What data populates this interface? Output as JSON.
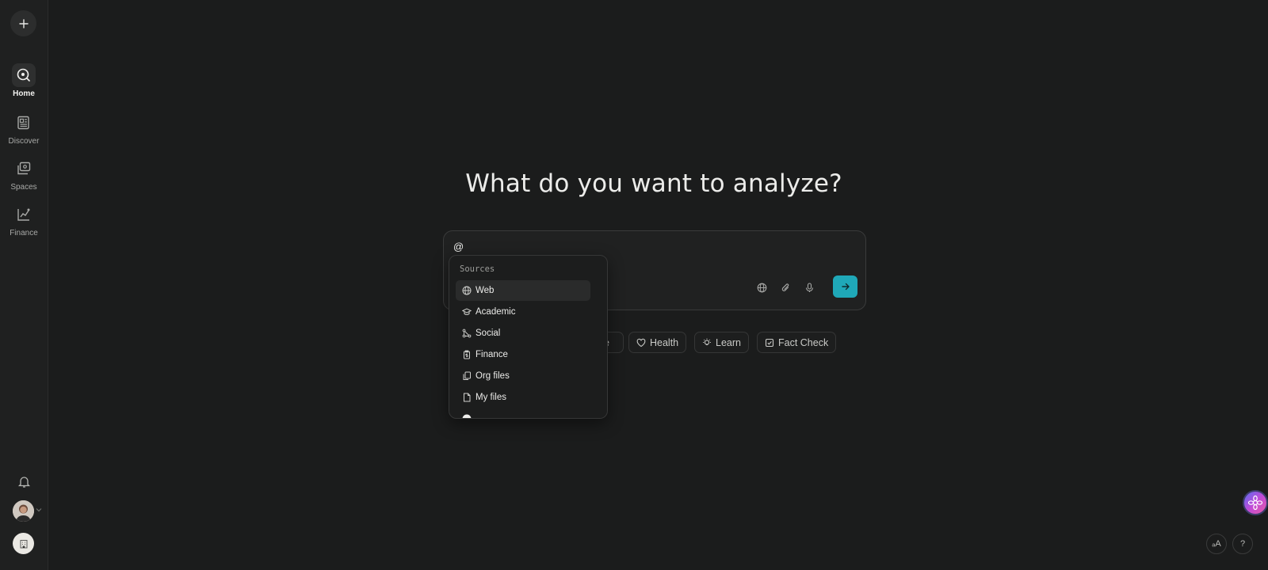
{
  "sidebar": {
    "new_thread_icon": "plus-icon",
    "items": [
      {
        "label": "Home",
        "icon": "home-search-icon",
        "active": true
      },
      {
        "label": "Discover",
        "icon": "newspaper-icon",
        "active": false
      },
      {
        "label": "Spaces",
        "icon": "spaces-icon",
        "active": false
      },
      {
        "label": "Finance",
        "icon": "chart-icon",
        "active": false
      }
    ]
  },
  "main": {
    "headline": "What do you want to analyze?",
    "composer_value": "@",
    "submit_color": "#1fa8b8"
  },
  "chips": [
    {
      "label": "e",
      "icon": null
    },
    {
      "label": "Health",
      "icon": "heart-icon"
    },
    {
      "label": "Learn",
      "icon": "bulb-icon"
    },
    {
      "label": "Fact Check",
      "icon": "check-square-icon"
    }
  ],
  "sources_menu": {
    "header": "Sources",
    "items": [
      {
        "label": "Web",
        "icon": "globe-icon"
      },
      {
        "label": "Academic",
        "icon": "graduation-cap-icon"
      },
      {
        "label": "Social",
        "icon": "social-network-icon"
      },
      {
        "label": "Finance",
        "icon": "clipboard-dollar-icon"
      },
      {
        "label": "Org files",
        "icon": "files-icon"
      },
      {
        "label": "My files",
        "icon": "file-icon"
      }
    ]
  },
  "corner": {
    "translate_label": "ₐA",
    "help_label": "?"
  }
}
